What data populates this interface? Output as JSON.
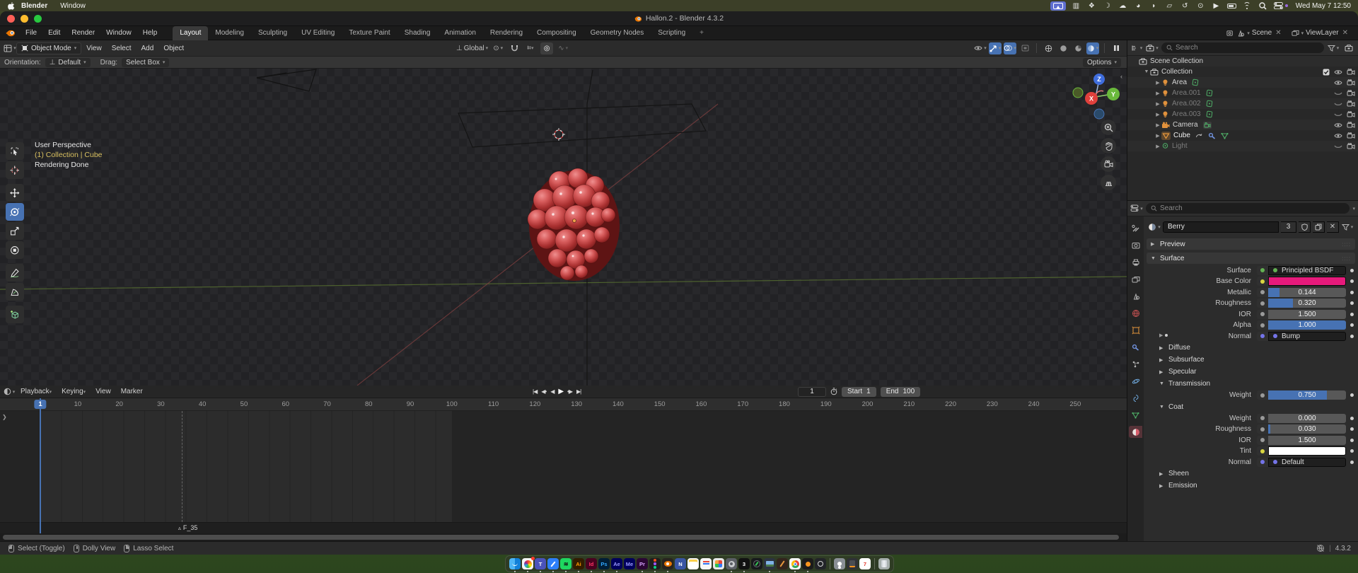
{
  "menubar": {
    "app_name": "Blender",
    "menus": [
      "Window"
    ],
    "clock": "Wed May 7 12:50",
    "icons": [
      "screen-mirroring",
      "stage-manager",
      "photos",
      "do-not-disturb",
      "cloud",
      "browser",
      "notifications",
      "windows",
      "time-machine",
      "key",
      "play-circle",
      "battery",
      "wifi",
      "spotlight",
      "control-center"
    ]
  },
  "window": {
    "title": "Hallon.2 - Blender 4.3.2"
  },
  "topbar": {
    "menus": [
      "File",
      "Edit",
      "Render",
      "Window",
      "Help"
    ],
    "tabs": [
      "Layout",
      "Modeling",
      "Sculpting",
      "UV Editing",
      "Texture Paint",
      "Shading",
      "Animation",
      "Rendering",
      "Compositing",
      "Geometry Nodes",
      "Scripting"
    ],
    "active_tab": "Layout",
    "add_tab_label": "+",
    "scene_name": "Scene",
    "view_layer_name": "ViewLayer"
  },
  "viewport_header": {
    "mode": "Object Mode",
    "menus": [
      "View",
      "Select",
      "Add",
      "Object"
    ],
    "orientation": "Global"
  },
  "tool_settings": {
    "orientation_label": "Orientation:",
    "orientation_value": "Default",
    "drag_label": "Drag:",
    "drag_value": "Select Box",
    "options_label": "Options"
  },
  "viewport": {
    "overlay": [
      "User Perspective",
      "(1) Collection | Cube",
      "Rendering Done"
    ],
    "gizmo_axes": {
      "x": "X",
      "y": "Y",
      "z": "Z"
    }
  },
  "outliner": {
    "search_placeholder": "Search",
    "rows": [
      {
        "label": "Scene Collection",
        "depth": 0,
        "icon": "collection",
        "disclosure": null
      },
      {
        "label": "Collection",
        "depth": 1,
        "icon": "collection",
        "disclosure": "open",
        "checkbox": true,
        "eye": "open",
        "camera": true
      },
      {
        "label": "Area",
        "depth": 2,
        "icon": "light-area",
        "extras": [
          "light-data"
        ],
        "disclosure": "closed",
        "eye": "open",
        "camera": true
      },
      {
        "label": "Area.001",
        "depth": 2,
        "icon": "light-area",
        "extras": [
          "light-data"
        ],
        "disclosure": "closed",
        "dim": true,
        "eye": "closed",
        "camera": true
      },
      {
        "label": "Area.002",
        "depth": 2,
        "icon": "light-area",
        "extras": [
          "light-data"
        ],
        "disclosure": "closed",
        "dim": true,
        "eye": "closed",
        "camera": true
      },
      {
        "label": "Area.003",
        "depth": 2,
        "icon": "light-area",
        "extras": [
          "light-data"
        ],
        "disclosure": "closed",
        "dim": true,
        "eye": "closed",
        "camera": true
      },
      {
        "label": "Camera",
        "depth": 2,
        "icon": "camera-object",
        "extras": [
          "camera-data"
        ],
        "disclosure": "closed",
        "eye": "open",
        "camera": true
      },
      {
        "label": "Cube",
        "depth": 2,
        "icon": "mesh-object-active",
        "extras": [
          "anim",
          "modifier",
          "mesh-data"
        ],
        "disclosure": "closed",
        "selected": true,
        "eye": "open",
        "camera": true
      },
      {
        "label": "Light",
        "depth": 2,
        "icon": "light-point",
        "extras": [],
        "disclosure": "closed",
        "dim": true,
        "eye": "closed",
        "camera": true
      }
    ]
  },
  "properties": {
    "search_placeholder": "Search",
    "tabs": [
      "tool",
      "render",
      "output",
      "view-layer",
      "scene",
      "world",
      "object",
      "modifiers",
      "particles",
      "physics",
      "constraints",
      "data",
      "material"
    ],
    "active_tab": "material",
    "datablock": {
      "name": "Berry",
      "users": "3"
    },
    "rows": [
      {
        "kind": "panel",
        "label": "Preview",
        "expanded": false
      },
      {
        "kind": "panel",
        "label": "Surface",
        "expanded": true
      },
      {
        "kind": "node",
        "label": "Surface",
        "value": "Principled BSDF",
        "socket": "#63b152"
      },
      {
        "kind": "color",
        "label": "Base Color",
        "color": "#e61a7b",
        "socket": "#d9d641"
      },
      {
        "kind": "slider",
        "label": "Metallic",
        "value": "0.144",
        "fill": 0.144
      },
      {
        "kind": "slider",
        "label": "Roughness",
        "value": "0.320",
        "fill": 0.32
      },
      {
        "kind": "slider",
        "label": "IOR",
        "value": "1.500",
        "fill": 0
      },
      {
        "kind": "slider",
        "label": "Alpha",
        "value": "1.000",
        "fill": 1
      },
      {
        "kind": "node",
        "label": "Normal",
        "value": "Bump",
        "socket": "#7474e8",
        "expander": true
      },
      {
        "kind": "subpanel",
        "label": "Diffuse",
        "expanded": false
      },
      {
        "kind": "subpanel",
        "label": "Subsurface",
        "expanded": false
      },
      {
        "kind": "subpanel",
        "label": "Specular",
        "expanded": false
      },
      {
        "kind": "subpanel",
        "label": "Transmission",
        "expanded": true
      },
      {
        "kind": "slider",
        "label": "Weight",
        "value": "0.750",
        "fill": 0.75
      },
      {
        "kind": "subpanel",
        "label": "Coat",
        "expanded": true
      },
      {
        "kind": "slider",
        "label": "Weight",
        "value": "0.000",
        "fill": 0
      },
      {
        "kind": "slider",
        "label": "Roughness",
        "value": "0.030",
        "fill": 0.03
      },
      {
        "kind": "slider",
        "label": "IOR",
        "value": "1.500",
        "fill": 0
      },
      {
        "kind": "color",
        "label": "Tint",
        "color": "#ffffff",
        "socket": "#d9d641"
      },
      {
        "kind": "node",
        "label": "Normal",
        "value": "Default",
        "socket": "#7474e8"
      },
      {
        "kind": "subpanel",
        "label": "Sheen",
        "expanded": false
      },
      {
        "kind": "subpanel",
        "label": "Emission",
        "expanded": false
      }
    ]
  },
  "timeline": {
    "menus": [
      "Playback",
      "Keying",
      "View",
      "Marker"
    ],
    "ticks": [
      10,
      20,
      30,
      40,
      50,
      60,
      70,
      80,
      90,
      100,
      110,
      120,
      130,
      140,
      150,
      160,
      170,
      180,
      190,
      200,
      210,
      220,
      230,
      240,
      250
    ],
    "current_frame": "1",
    "start_label": "Start",
    "start_value": "1",
    "end_label": "End",
    "end_value": "100",
    "marker_label": "F_35",
    "marker_frame": 35,
    "range_start": 1,
    "range_end": 100
  },
  "statusbar": {
    "hints": [
      "Select (Toggle)",
      "Dolly View",
      "Lasso Select"
    ],
    "version": "4.3.2"
  },
  "dock": {
    "apps": [
      {
        "name": "finder",
        "bg": "#1e9ced",
        "glyph": "finder",
        "dot": true
      },
      {
        "name": "photos",
        "bg": "#f5f5f5",
        "glyph": "flower",
        "badge": true,
        "dot": true
      },
      {
        "name": "teams",
        "bg": "#4a53bb",
        "label": "T",
        "fg": "#ffffff",
        "dot": true
      },
      {
        "name": "freeform",
        "bg": "#2d7ff9",
        "glyph": "pen",
        "dot": true
      },
      {
        "name": "spotify",
        "bg": "#1ed760",
        "glyph": "spotify",
        "dot": true
      },
      {
        "name": "illustrator",
        "bg": "#331c00",
        "label": "Ai",
        "fg": "#ff9a00",
        "dot": true
      },
      {
        "name": "indesign",
        "bg": "#49021f",
        "label": "Id",
        "fg": "#ff3366",
        "dot": true
      },
      {
        "name": "photoshop",
        "bg": "#001e36",
        "label": "Ps",
        "fg": "#31a8ff",
        "dot": true
      },
      {
        "name": "after-effects",
        "bg": "#00005b",
        "label": "Ae",
        "fg": "#9999ff",
        "dot": true
      },
      {
        "name": "media-encoder",
        "bg": "#00005b",
        "label": "Me",
        "fg": "#9999ff"
      },
      {
        "name": "premiere",
        "bg": "#2a0634",
        "label": "Pr",
        "fg": "#d6a3ff",
        "dot": true
      },
      {
        "name": "figma",
        "bg": "#1e1e1e",
        "glyph": "figma",
        "dot": true
      },
      {
        "name": "blender",
        "bg": "#28241f",
        "glyph": "blender",
        "dot": true
      },
      {
        "name": "onenote",
        "bg": "#3955a3",
        "label": "N",
        "fg": "#ffffff"
      },
      {
        "name": "notes",
        "bg": "#f7f7f7",
        "glyph": "notes"
      },
      {
        "name": "reminders",
        "bg": "#f7f7f7",
        "glyph": "list"
      },
      {
        "name": "launchpad",
        "bg": "#e8e8e8",
        "glyph": "grid"
      },
      {
        "name": "system-settings",
        "bg": "#5c5f66",
        "glyph": "gear",
        "dot": true
      },
      {
        "name": "app-three",
        "bg": "#111111",
        "label": "3",
        "fg": "#ffffff",
        "dot": true
      },
      {
        "name": "compass-app",
        "bg": "#17191c",
        "glyph": "compass"
      },
      {
        "name": "preview-app",
        "bg": "#2c3340",
        "glyph": "photo",
        "dot": true
      },
      {
        "name": "garageband",
        "bg": "#33241c",
        "glyph": "guitar"
      },
      {
        "name": "chrome",
        "bg": "#f5f5f5",
        "glyph": "chrome",
        "dot": true
      },
      {
        "name": "fl-studio",
        "bg": "#1b1b1b",
        "glyph": "fruit",
        "dot": true
      },
      {
        "name": "app-dark",
        "bg": "#222428",
        "glyph": "circle"
      },
      {
        "sep": true
      },
      {
        "name": "contacts",
        "bg": "#8a9096",
        "glyph": "person"
      },
      {
        "name": "calculator",
        "bg": "#2f3136",
        "glyph": "calc"
      },
      {
        "name": "calendar",
        "bg": "#ffffff",
        "label": "7",
        "fg": "#e33b30"
      },
      {
        "sep": true
      },
      {
        "name": "trash",
        "bg": "rgba(210,215,220,.75)",
        "glyph": "trash"
      }
    ]
  },
  "colors": {
    "accent": "#4772b3",
    "base_color": "#e61a7b",
    "active_object": "#e8983c",
    "axis_x": "#e0403c",
    "axis_y": "#6ab93c",
    "axis_z": "#3f6ddd"
  }
}
